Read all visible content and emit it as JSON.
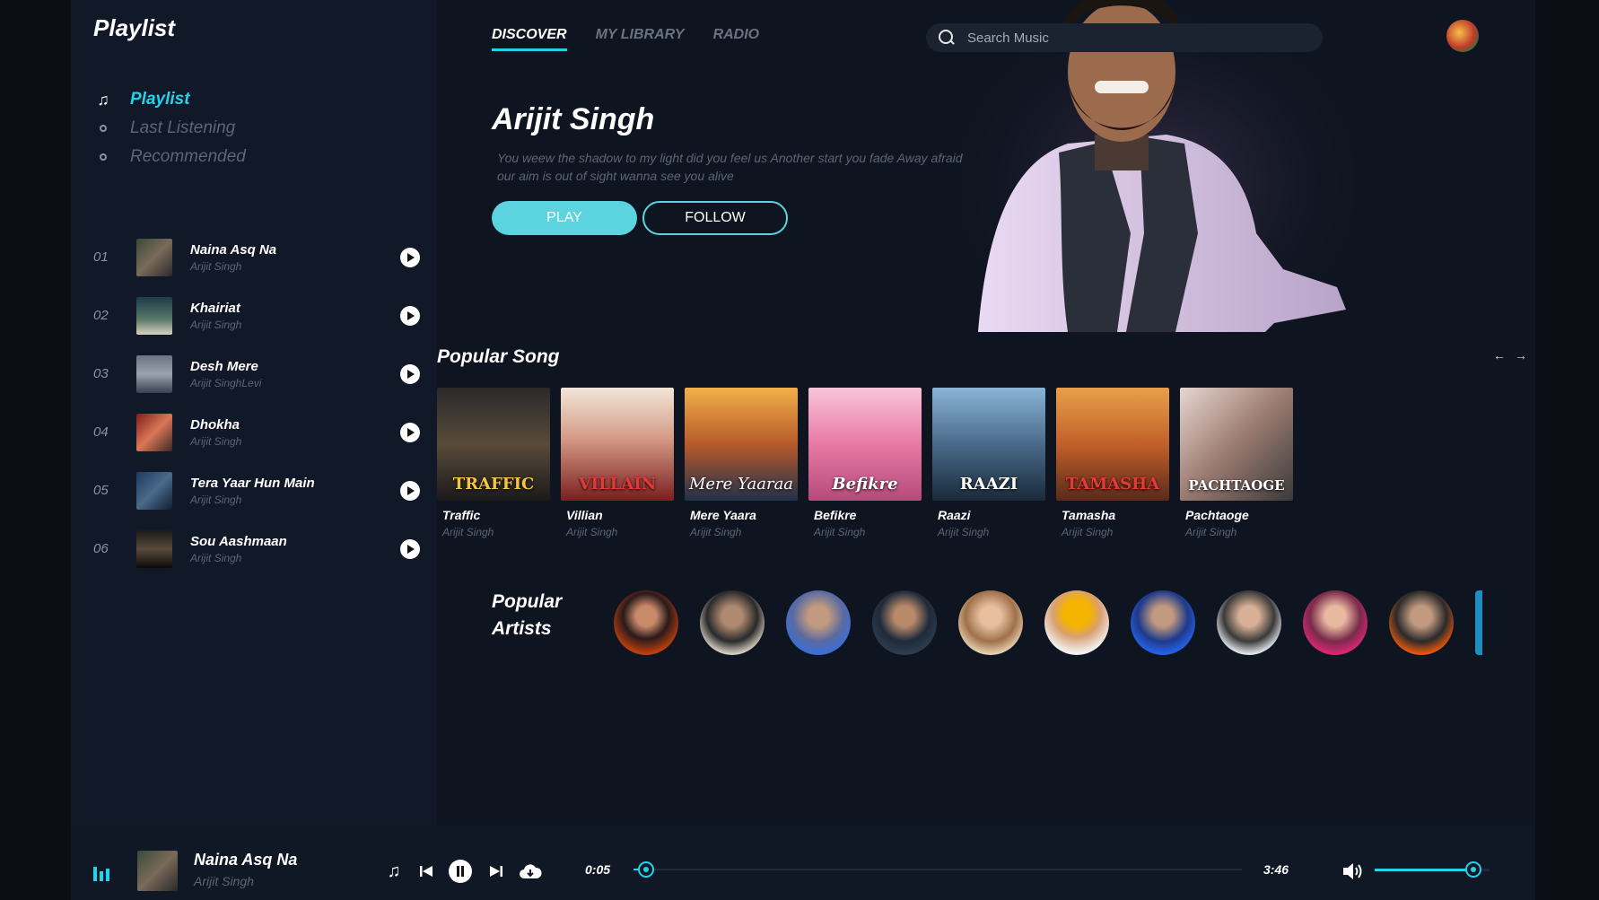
{
  "sidebar": {
    "title": "Playlist",
    "nav": [
      {
        "label": "Playlist",
        "active": true,
        "icon": "music-note-icon"
      },
      {
        "label": "Last Listening",
        "active": false,
        "icon": "circle-icon"
      },
      {
        "label": "Recommended",
        "active": false,
        "icon": "circle-icon"
      }
    ],
    "tracks": [
      {
        "num": "01",
        "title": "Naina Asq Na",
        "artist": "Arijit Singh"
      },
      {
        "num": "02",
        "title": "Khairiat",
        "artist": "Arijit Singh"
      },
      {
        "num": "03",
        "title": "Desh Mere",
        "artist": "Arijit SinghLevi"
      },
      {
        "num": "04",
        "title": "Dhokha",
        "artist": "Arijit Singh"
      },
      {
        "num": "05",
        "title": "Tera Yaar Hun Main",
        "artist": "Arijit Singh"
      },
      {
        "num": "06",
        "title": "Sou Aashmaan",
        "artist": "Arijit Singh"
      }
    ]
  },
  "header": {
    "tabs": [
      {
        "label": "DISCOVER",
        "active": true
      },
      {
        "label": "MY LIBRARY",
        "active": false
      },
      {
        "label": "RADIO",
        "active": false
      }
    ],
    "search_placeholder": "Search Music"
  },
  "hero": {
    "artist": "Arijit Singh",
    "description": "You weew the shadow to my light did you feel us Another start you fade Away afraid our aim is out of sight wanna see you alive",
    "play_label": "PLAY",
    "follow_label": "FOLLOW"
  },
  "popular_songs": {
    "title": "Popular Song",
    "items": [
      {
        "title": "Traffic",
        "artist": "Arijit Singh",
        "cover_text": "TRAFFIC"
      },
      {
        "title": "Villian",
        "artist": "Arijit Singh",
        "cover_text": "VILLAIN"
      },
      {
        "title": "Mere Yaara",
        "artist": "Arijit Singh",
        "cover_text": "Mere Yaaraa"
      },
      {
        "title": "Befikre",
        "artist": "Arijit Singh",
        "cover_text": "Befikre"
      },
      {
        "title": "Raazi",
        "artist": "Arijit Singh",
        "cover_text": "RAAZI"
      },
      {
        "title": "Tamasha",
        "artist": "Arijit Singh",
        "cover_text": "TAMASHA"
      },
      {
        "title": "Pachtaoge",
        "artist": "Arijit Singh",
        "cover_text": "PACHTAOGE"
      }
    ]
  },
  "popular_artists": {
    "title_line1": "Popular",
    "title_line2": "Artists"
  },
  "player": {
    "title": "Naina Asq Na",
    "artist": "Arijit Singh",
    "current_time": "0:05",
    "total_time": "3:46",
    "progress": 0.02,
    "volume": 0.86
  },
  "colors": {
    "accent": "#22d3ee",
    "background": "#0e1420",
    "sidebar": "#111827"
  }
}
